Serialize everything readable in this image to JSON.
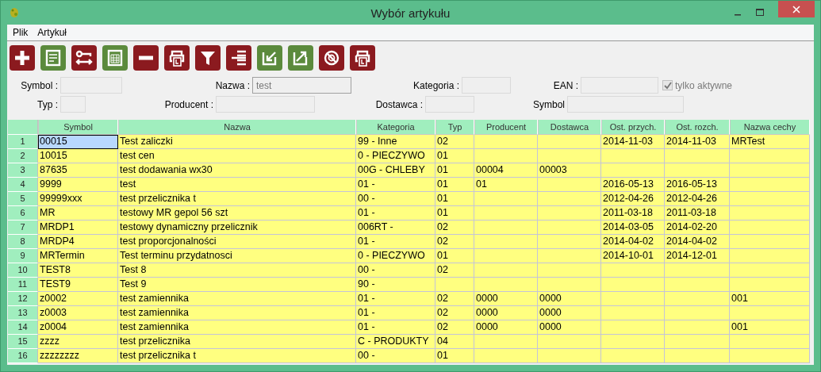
{
  "window": {
    "title": "Wybór artykułu"
  },
  "menu": [
    "Plik",
    "Artykuł"
  ],
  "toolbar": [
    {
      "kind": "plus",
      "color": "#8b1a1f"
    },
    {
      "kind": "document",
      "color": "#5b8a3c"
    },
    {
      "kind": "swap",
      "color": "#8b1a1f"
    },
    {
      "kind": "table",
      "color": "#5b8a3c"
    },
    {
      "kind": "minus",
      "color": "#8b1a1f"
    },
    {
      "kind": "printer",
      "color": "#8b1a1f"
    },
    {
      "kind": "filter",
      "color": "#8b1a1f"
    },
    {
      "kind": "list",
      "color": "#8b1a1f"
    },
    {
      "kind": "import",
      "color": "#5b8a3c"
    },
    {
      "kind": "export",
      "color": "#5b8a3c"
    },
    {
      "kind": "blocked",
      "color": "#8b1a1f"
    },
    {
      "kind": "printer",
      "color": "#8b1a1f"
    }
  ],
  "filters": {
    "symbol": {
      "label": "Symbol :"
    },
    "name": {
      "label": "Nazwa :",
      "value": "test"
    },
    "category": {
      "label": "Kategoria :"
    },
    "ean": {
      "label": "EAN :"
    },
    "active_only": {
      "label": "tylko aktywne",
      "checked": true,
      "disabled": true
    },
    "type": {
      "label": "Typ :"
    },
    "producer": {
      "label": "Producent :"
    },
    "supplier": {
      "label": "Dostawca :"
    },
    "symbol_2": {
      "label": "Symbol"
    }
  },
  "table": {
    "columns": [
      "Symbol",
      "Nazwa",
      "Kategoria",
      "Typ",
      "Producent",
      "Dostawca",
      "Ost. przych.",
      "Ost. rozch.",
      "Nazwa cechy"
    ],
    "rows": [
      {
        "num": "1",
        "selected": true,
        "cells": [
          "00015",
          "Test zaliczki",
          "99 - Inne",
          "02",
          "",
          "",
          "2014-11-03",
          "2014-11-03",
          "MRTest"
        ]
      },
      {
        "num": "2",
        "selected": false,
        "cells": [
          "10015",
          "test cen",
          "0 - PIECZYWO",
          "01",
          "",
          "",
          "",
          "",
          ""
        ]
      },
      {
        "num": "3",
        "selected": false,
        "cells": [
          "87635",
          "test dodawania wx30",
          "00G - CHLEBY",
          "01",
          "00004",
          "00003",
          "",
          "",
          ""
        ]
      },
      {
        "num": "4",
        "selected": false,
        "cells": [
          "9999",
          "test",
          "01 -",
          "01",
          "01",
          "",
          "2016-05-13",
          "2016-05-13",
          ""
        ]
      },
      {
        "num": "5",
        "selected": false,
        "cells": [
          "99999xxx",
          "test przelicznika t",
          "00 -",
          "01",
          "",
          "",
          "2012-04-26",
          "2012-04-26",
          ""
        ]
      },
      {
        "num": "6",
        "selected": false,
        "cells": [
          "MR",
          "testowy MR gepol 56 szt",
          "01 -",
          "01",
          "",
          "",
          "2011-03-18",
          "2011-03-18",
          ""
        ]
      },
      {
        "num": "7",
        "selected": false,
        "cells": [
          "MRDP1",
          "testowy dynamiczny przelicznik",
          "006RT -",
          "02",
          "",
          "",
          "2014-03-05",
          "2014-02-20",
          ""
        ]
      },
      {
        "num": "8",
        "selected": false,
        "cells": [
          "MRDP4",
          "test proporcjonalności",
          "01 -",
          "02",
          "",
          "",
          "2014-04-02",
          "2014-04-02",
          ""
        ]
      },
      {
        "num": "9",
        "selected": false,
        "cells": [
          "MRTermin",
          "Test terminu przydatnosci",
          "0 - PIECZYWO",
          "01",
          "",
          "",
          "2014-10-01",
          "2014-12-01",
          ""
        ]
      },
      {
        "num": "10",
        "selected": false,
        "cells": [
          "TEST8",
          "Test 8",
          "00 -",
          "02",
          "",
          "",
          "",
          "",
          ""
        ]
      },
      {
        "num": "11",
        "selected": false,
        "cells": [
          "TEST9",
          "Test 9",
          "90 -",
          "",
          "",
          "",
          "",
          "",
          ""
        ]
      },
      {
        "num": "12",
        "selected": false,
        "cells": [
          "z0002",
          "test zamiennika",
          "01 -",
          "02",
          "0000",
          "0000",
          "",
          "",
          "001"
        ]
      },
      {
        "num": "13",
        "selected": false,
        "cells": [
          "z0003",
          "test zamiennika",
          "01 -",
          "02",
          "0000",
          "0000",
          "",
          "",
          ""
        ]
      },
      {
        "num": "14",
        "selected": false,
        "cells": [
          "z0004",
          "test zamiennika",
          "01 -",
          "02",
          "0000",
          "0000",
          "",
          "",
          "001"
        ]
      },
      {
        "num": "15",
        "selected": false,
        "cells": [
          "zzzz",
          "test przelicznika",
          "C - PRODUKTY",
          "04",
          "",
          "",
          "",
          "",
          ""
        ]
      },
      {
        "num": "16",
        "selected": false,
        "cells": [
          "zzzzzzzz",
          "test przelicznika t",
          "00 -",
          "01",
          "",
          "",
          "",
          "",
          ""
        ]
      }
    ]
  }
}
